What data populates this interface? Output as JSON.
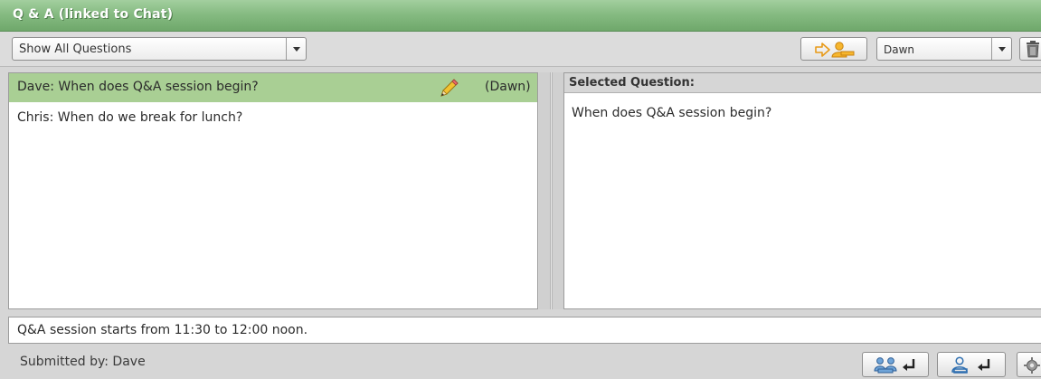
{
  "window": {
    "title": "Q & A (linked to Chat)"
  },
  "toolbar": {
    "filter_select": {
      "value": "Show All Questions"
    },
    "assign_button_icon": "arrow-to-user-icon",
    "user_select": {
      "value": "Dawn"
    },
    "delete_button_icon": "trash-icon"
  },
  "questions": [
    {
      "text": "Dave: When does Q&A session begin?",
      "assigned_to": "(Dawn)",
      "icon": "pencil-icon",
      "selected": true
    },
    {
      "text": "Chris: When do we break for lunch?",
      "assigned_to": "",
      "selected": false
    }
  ],
  "selected_question": {
    "header": "Selected Question:",
    "text": "When does Q&A session begin?"
  },
  "answer": {
    "text": "Q&A session starts from 11:30 to 12:00 noon."
  },
  "status": {
    "submitted_by": "Submitted by: Dave",
    "buttons": [
      "send-to-all-icon",
      "send-to-user-icon",
      "settings-icon"
    ]
  },
  "colors": {
    "title_bar": "#86bb82",
    "selected_row": "#a9cf94",
    "accent_orange": "#f0a020"
  }
}
